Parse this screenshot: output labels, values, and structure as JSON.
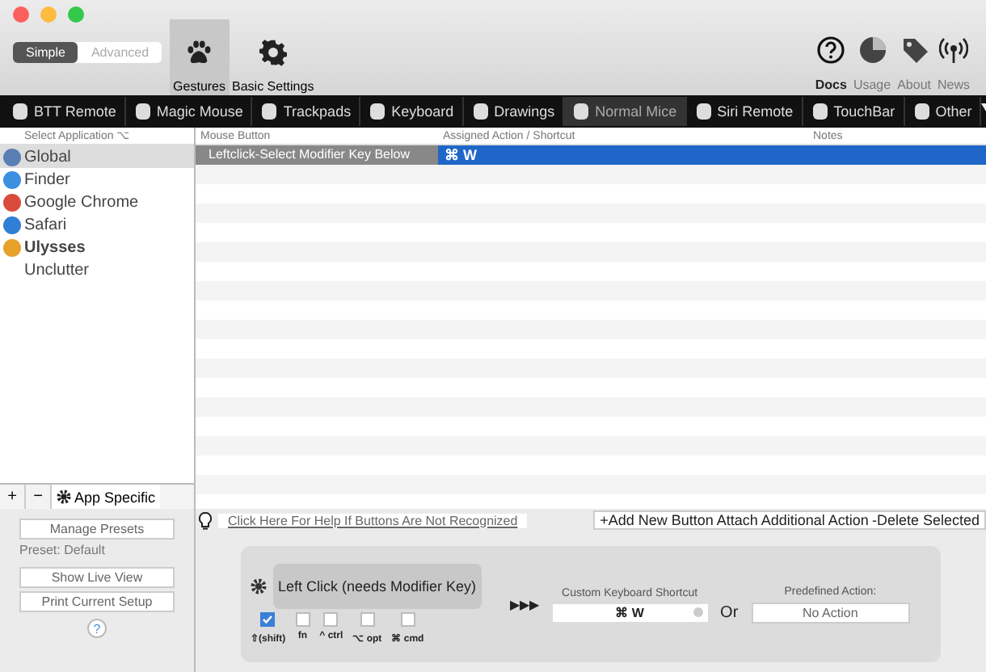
{
  "mode_switch": [
    {
      "label": "Simple",
      "selected": true
    },
    {
      "label": "Advanced",
      "selected": false
    }
  ],
  "toolbar": [
    {
      "label": "Gestures",
      "kind": "paw",
      "selected": true
    },
    {
      "label": "Basic Settings",
      "kind": "gear",
      "selected": false
    }
  ],
  "right_toolbar": [
    {
      "label": "Docs",
      "kind": "help",
      "bold": true
    },
    {
      "label": "Usage",
      "kind": "pie",
      "bold": false
    },
    {
      "label": "About",
      "kind": "tag",
      "bold": false
    },
    {
      "label": "News",
      "kind": "antenna",
      "bold": false
    }
  ],
  "device_tabs": [
    {
      "label": "BTT Remote",
      "selected": false
    },
    {
      "label": "Magic Mouse",
      "selected": false
    },
    {
      "label": "Trackpads",
      "selected": false
    },
    {
      "label": "Keyboard",
      "selected": false
    },
    {
      "label": "Drawings",
      "selected": false
    },
    {
      "label": "Normal Mice",
      "selected": true
    },
    {
      "label": "Siri Remote",
      "selected": false
    },
    {
      "label": "TouchBar",
      "selected": false
    },
    {
      "label": "Other",
      "selected": false
    }
  ],
  "sidebar": {
    "header": "Select Application ⌥",
    "items": [
      {
        "label": "Global",
        "color": "#5a7fb5",
        "bold": false,
        "selected": true
      },
      {
        "label": "Finder",
        "color": "#3d8fe0",
        "bold": false,
        "selected": false
      },
      {
        "label": "Google Chrome",
        "color": "#d94b3b",
        "bold": false,
        "selected": false
      },
      {
        "label": "Safari",
        "color": "#2f7fd6",
        "bold": false,
        "selected": false
      },
      {
        "label": "Ulysses",
        "color": "#e5a12a",
        "bold": true,
        "selected": false
      },
      {
        "label": "Unclutter",
        "bold": false,
        "selected": false
      }
    ],
    "footer": {
      "add": "+",
      "remove": "−",
      "menu": "App Specific"
    }
  },
  "table": {
    "columns": [
      "Mouse Button",
      "Assigned Action / Shortcut",
      "Notes"
    ],
    "rows": [
      {
        "mouse_button": "Leftclick-Select Modifier Key Below",
        "shortcut": "⌘ W",
        "selected": true
      }
    ]
  },
  "left_panel": {
    "manage": "Manage Presets",
    "preset": "Preset: Default",
    "live_view": "Show Live View",
    "print": "Print Current Setup",
    "help": "?"
  },
  "help_link": "Click Here For Help If Buttons Are Not Recognized",
  "actions": [
    "+Add New Button",
    "Attach Additional Action",
    "-Delete Selected"
  ],
  "editor": {
    "trigger": "Left Click (needs Modifier Key)",
    "arrows": "▶▶▶",
    "shortcut_label": "Custom Keyboard Shortcut",
    "shortcut_value": "⌘ W",
    "or": "Or",
    "predefined_label": "Predefined Action:",
    "predefined_value": "No Action",
    "modifiers": [
      {
        "label": "⇧(shift)",
        "checked": true
      },
      {
        "label": "fn",
        "checked": false
      },
      {
        "label": "^ ctrl",
        "checked": false
      },
      {
        "label": "⌥ opt",
        "checked": false
      },
      {
        "label": "⌘ cmd",
        "checked": false
      }
    ]
  }
}
